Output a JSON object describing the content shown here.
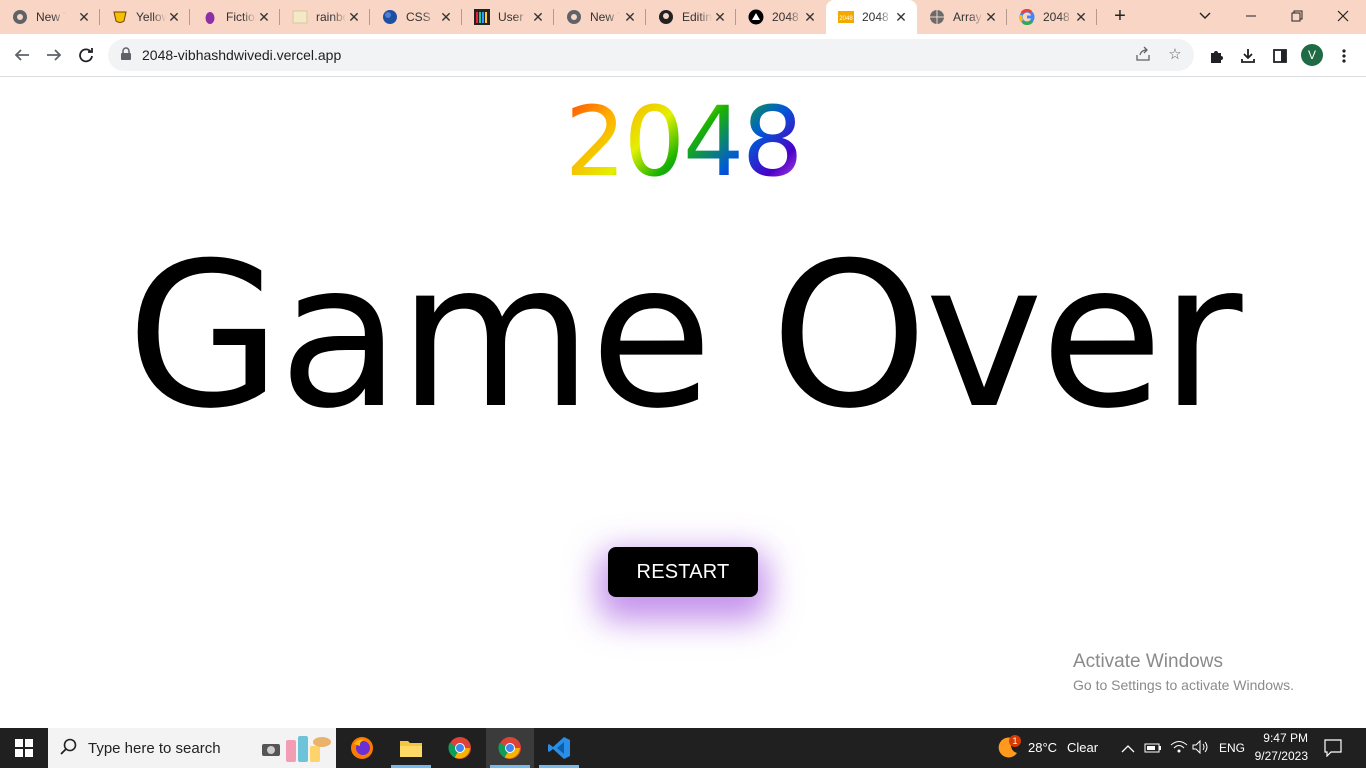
{
  "browser": {
    "tabs": [
      {
        "title": "New Tab",
        "icon": "chrome-icon"
      },
      {
        "title": "Yellow",
        "icon": "yellow-mask-icon"
      },
      {
        "title": "Fiction",
        "icon": "purple-drop-icon"
      },
      {
        "title": "rainbow",
        "icon": "image-icon"
      },
      {
        "title": "CSS",
        "icon": "blue-circle-icon"
      },
      {
        "title": "User",
        "icon": "bars-icon"
      },
      {
        "title": "New Tab",
        "icon": "chrome-icon"
      },
      {
        "title": "Editing",
        "icon": "github-icon"
      },
      {
        "title": "2048",
        "icon": "vercel-icon"
      },
      {
        "title": "2048",
        "icon": "2048-icon",
        "active": true
      },
      {
        "title": "Array",
        "icon": "globe-icon"
      },
      {
        "title": "2048",
        "icon": "google-icon"
      }
    ],
    "url": "2048-vibhashdwivedi.vercel.app",
    "profile_initial": "V"
  },
  "page": {
    "brand": "2048",
    "heading": "Game Over",
    "restart_label": "RESTART",
    "activation": {
      "title": "Activate Windows",
      "subtitle": "Go to Settings to activate Windows."
    }
  },
  "taskbar": {
    "search_placeholder": "Type here to search",
    "weather": {
      "temp": "28°C",
      "condition": "Clear",
      "badge": "1"
    },
    "language": "ENG",
    "time": "9:47 PM",
    "date": "9/27/2023"
  },
  "colors": {
    "tabstrip": "#f8d5c4",
    "button": "#000000",
    "glow": "#9b3cdc"
  }
}
